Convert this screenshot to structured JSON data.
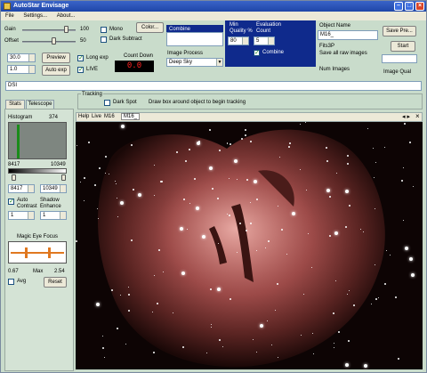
{
  "window": {
    "title": "AutoStar Envisage"
  },
  "menu": [
    "File",
    "Settings...",
    "About..."
  ],
  "controls": {
    "gain_label": "Gain",
    "gain_max": "100",
    "offset_label": "Offset",
    "offset_max": "50",
    "gain_level": 0.85,
    "offset_level": 0.6,
    "exposure_value": "30.0",
    "binning_value": "1.0",
    "preview_label": "Preview",
    "autoexp_label": "Auto exp",
    "mono_label": "Mono",
    "dark_subtract_label": "Dark Subtract",
    "long_exp_label": "Long exp",
    "live_label": "LIVE",
    "count_down_label": "Count Down",
    "count_down_value": "0.0",
    "color_button": "Color...",
    "combine_label": "Combine",
    "image_process_label": "Image Process",
    "image_process_value": "Deep Sky",
    "min_quality_label": "Min Quality %",
    "min_quality_value": "80",
    "evaluation_count_label": "Evaluation Count",
    "evaluation_count_value": "5",
    "combine_check_label": "Combine",
    "object_name_label": "Object Name",
    "object_name_value": "M16_",
    "save_prefix_label": "Save Pre...",
    "start_label": "Start",
    "fits_label": "Fits3P",
    "save_all_label": "Save all raw images",
    "num_images_label": "Num Images",
    "image_qual_label": "Image Qual",
    "dsi_label": "DSI",
    "tracking_label": "Tracking",
    "dark_spot_label": "Dark Spot",
    "tracking_hint": "Draw box around object to begin tracking"
  },
  "left_panel": {
    "tabs": [
      "Stats",
      "Telescope"
    ],
    "histogram_label": "Histogram",
    "histogram_value": "374",
    "hist_min": "8417",
    "hist_max": "10349",
    "low_value": "8417",
    "high_value": "10349",
    "auto_contrast_label": "Auto Contrast",
    "shadow_enhance_label": "Shadow Enhance",
    "contrast_value": "1",
    "shadow_value": "1",
    "magic_eye_label": "Magic Eye Focus",
    "focus_current": "0.67",
    "focus_max_label": "Max",
    "focus_max": "2.54",
    "avg_label": "Avg",
    "reset_label": "Reset"
  },
  "image_tabs": [
    "Help",
    "Live",
    "M16",
    "M16_"
  ],
  "colors": {
    "title_bar": "#2a55c0",
    "panel_blue": "#0f2a8c",
    "app_bg": "#c9dccb",
    "countdown_red": "#ff2020"
  }
}
